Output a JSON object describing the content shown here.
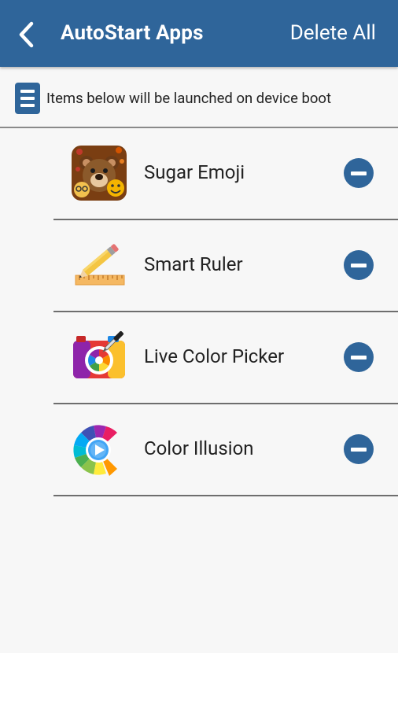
{
  "header": {
    "title": "AutoStart Apps",
    "action_label": "Delete All",
    "back_icon": "chevron-left-icon"
  },
  "info": {
    "text": "Items below will be launched on device boot",
    "icon": "list-icon"
  },
  "apps": [
    {
      "name": "Sugar Emoji",
      "icon": "sugar-emoji-icon"
    },
    {
      "name": "Smart Ruler",
      "icon": "smart-ruler-icon"
    },
    {
      "name": "Live Color Picker",
      "icon": "live-color-picker-icon"
    },
    {
      "name": "Color Illusion",
      "icon": "color-illusion-icon"
    }
  ],
  "colors": {
    "primary": "#2f659a",
    "background": "#f7f7f7",
    "text": "#222222"
  }
}
